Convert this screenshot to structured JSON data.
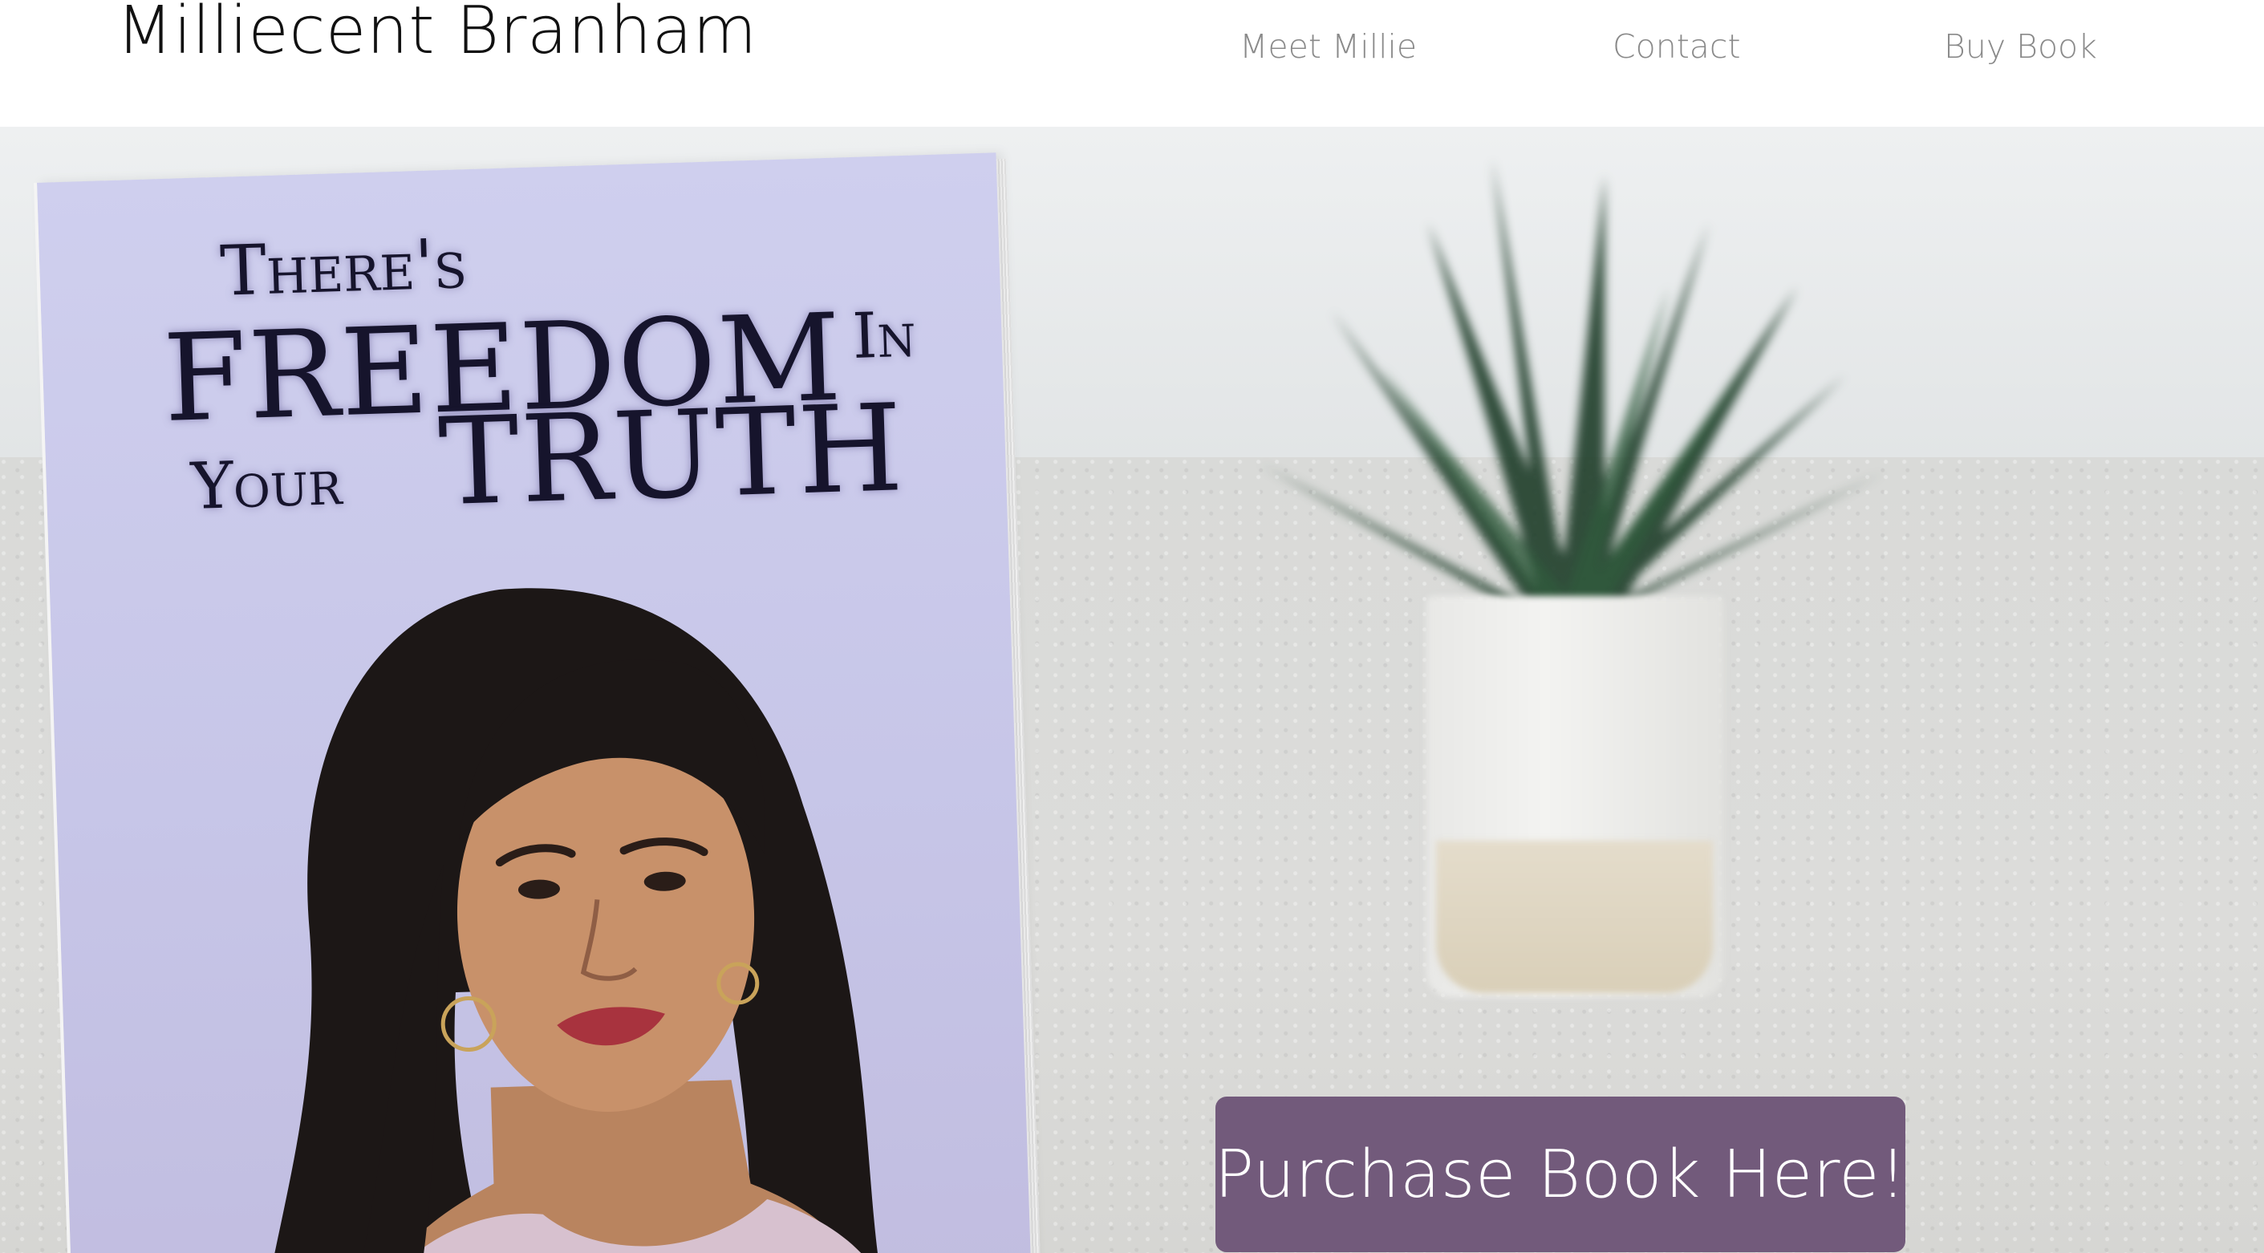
{
  "header": {
    "site_title": "Milliecent Branham",
    "nav": [
      {
        "label": "Meet Millie"
      },
      {
        "label": "Contact"
      },
      {
        "label": "Buy Book"
      }
    ]
  },
  "hero": {
    "book": {
      "title_line1": "There's",
      "title_line2": "FREEDOM",
      "title_line2b": "In",
      "title_line3": "Your",
      "title_line3b": "TRUTH"
    },
    "cta_label": "Purchase Book Here!"
  },
  "colors": {
    "cta_background": "#725a7b",
    "cta_text": "#ffffff",
    "nav_text": "#8a8a8a",
    "title_text": "#111111",
    "book_cover": "#cfcfee"
  }
}
